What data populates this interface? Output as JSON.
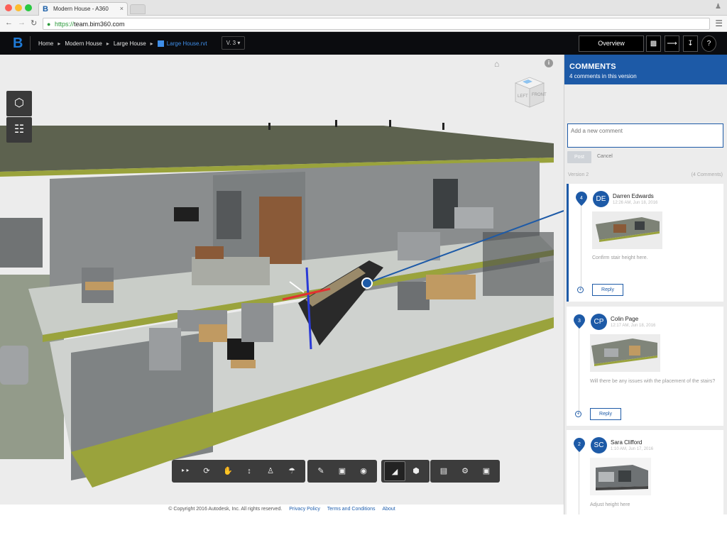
{
  "browser": {
    "tab_title": "Modern House - A360",
    "tab_favicon": "B",
    "tab_close": "×",
    "url_scheme": "https://",
    "url_host": "team.bim360.com"
  },
  "header": {
    "logo_letter": "B",
    "breadcrumbs": [
      "Home",
      "Modern House",
      "Large House"
    ],
    "file_name": "Large House.rvt",
    "version_label": "V. 3",
    "overview_label": "Overview",
    "accent": "#1d5aa7"
  },
  "viewer": {
    "viewcube_faces": [
      "FRONT",
      "LEFT"
    ],
    "toolbar_groups": [
      [
        "walk-icon",
        "orbit-icon",
        "pan-icon",
        "dolly-icon",
        "first-person-icon",
        "camera-icon"
      ],
      [
        "markup-pencil-icon",
        "comment-icon",
        "eye-icon"
      ],
      [
        "section-icon",
        "explode-icon"
      ],
      [
        "model-browser-icon",
        "settings-icon",
        "fullscreen-icon"
      ]
    ]
  },
  "footer": {
    "copyright": "© Copyright 2016 Autodesk, Inc. All rights reserved.",
    "links": [
      "Privacy Policy",
      "Terms and Conditions",
      "About"
    ]
  },
  "comments": {
    "title": "COMMENTS",
    "subtitle": "4 comments in this version",
    "placeholder": "Add a new comment",
    "post_label": "Post",
    "cancel_label": "Cancel",
    "version_label": "Version 2",
    "count_label": "(4 Comments)",
    "reply_label": "Reply",
    "items": [
      {
        "number": "4",
        "initials": "DE",
        "author": "Darren Edwards",
        "date": "12:26 AM, Jun 18, 2016",
        "text": "Confirm stair height here."
      },
      {
        "number": "3",
        "initials": "CP",
        "author": "Colin Page",
        "date": "12:17 AM, Jun 18, 2016",
        "text": "Will there be any issues with the placement of the stairs?"
      },
      {
        "number": "2",
        "initials": "SC",
        "author": "Sara Clifford",
        "date": "1:10 AM, Jun 17, 2016",
        "text": "Adjust height here"
      }
    ]
  }
}
